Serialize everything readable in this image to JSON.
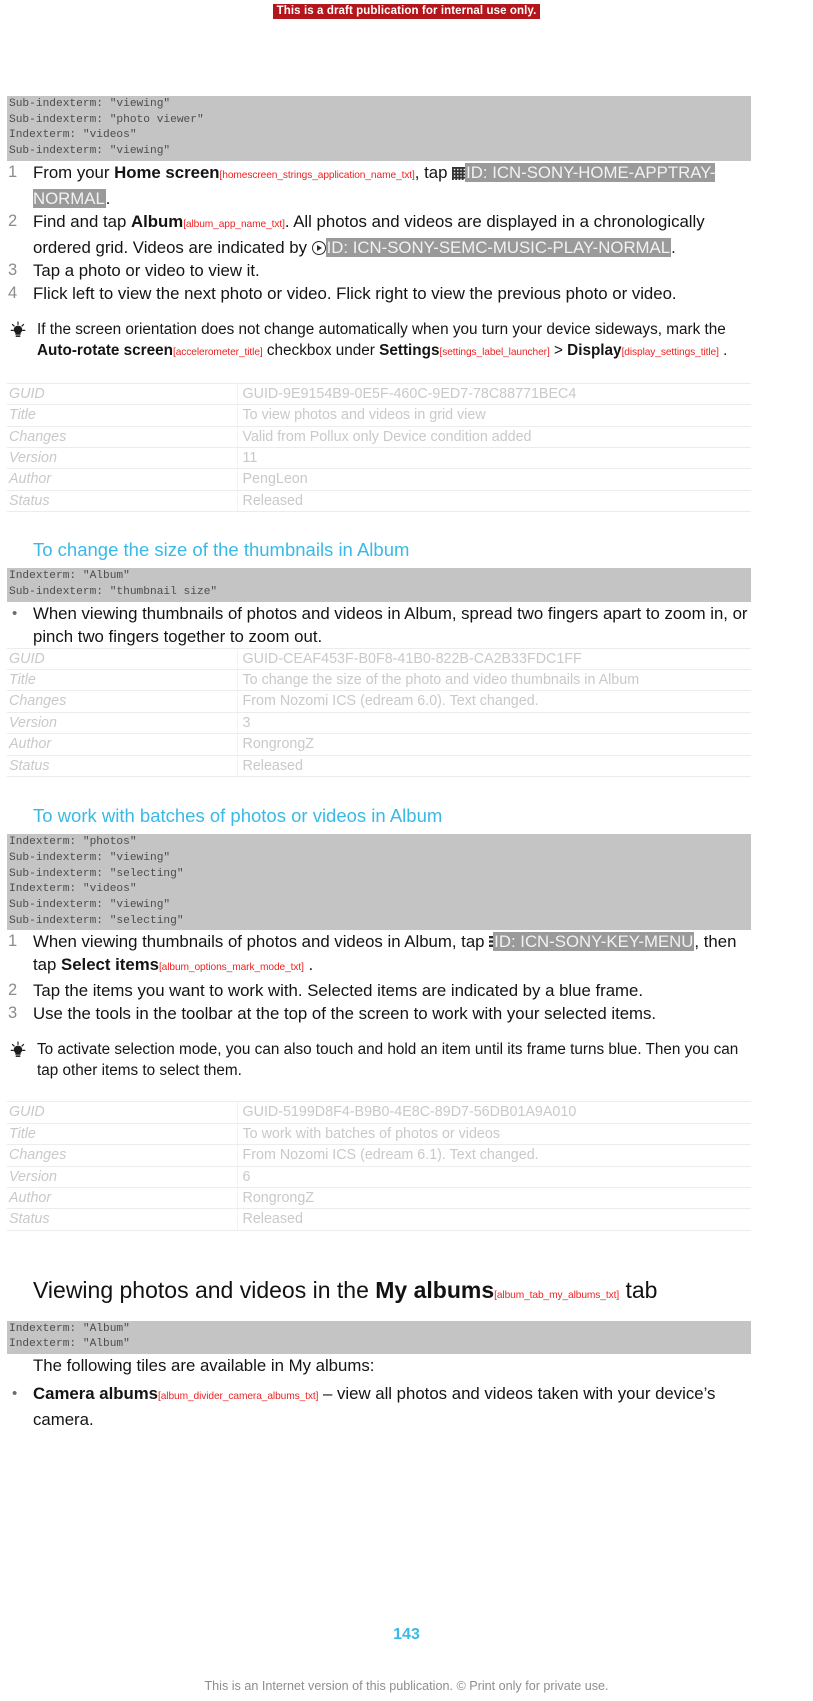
{
  "draft_banner": "This is a draft publication for internal use only.",
  "colors": {
    "accent": "#39b9e8",
    "draft_banner_bg": "#b3161b",
    "index_block_bg": "#c4c4c4",
    "string_id": "#ee2222",
    "icn_highlight": "#9a9a9a"
  },
  "section1": {
    "index_lines": [
      "Sub-indexterm: \"viewing\"",
      "Sub-indexterm: \"photo viewer\"",
      "Indexterm: \"videos\"",
      "Sub-indexterm: \"viewing\""
    ],
    "steps": [
      {
        "num": "1",
        "pre": "From your ",
        "ui1": "Home screen",
        "sid1": "[homescreen_strings_application_name_txt]",
        "mid": ", tap ",
        "icon": "apptray-grid-icon",
        "icn": "ID: ICN-SONY-HOME-APPTRAY-NORMAL",
        "post": "."
      },
      {
        "num": "2",
        "pre": "Find and tap ",
        "ui1": "Album",
        "sid1": "[album_app_name_txt]",
        "mid": ". All photos and videos are displayed in a chronologically ordered grid. Videos are indicated by ",
        "icon": "play-circle-icon",
        "icn": "ID: ICN-SONY-SEMC-MUSIC-PLAY-NORMAL",
        "post": "."
      },
      {
        "num": "3",
        "text": "Tap a photo or video to view it."
      },
      {
        "num": "4",
        "text": "Flick left to view the next photo or video. Flick right to view the previous photo or video."
      }
    ],
    "tip": {
      "p1": "If the screen orientation does not change automatically when you turn your device sideways, mark the ",
      "ui1": "Auto-rotate screen",
      "sid1": "[accelerometer_title]",
      "p2": " checkbox under ",
      "ui2": "Settings",
      "sid2": "[settings_label_launcher]",
      "p3": " > ",
      "ui3": "Display",
      "sid3": "[display_settings_title]",
      "p4": " ."
    },
    "meta": {
      "rows": [
        {
          "key": "GUID",
          "value": "GUID-9E9154B9-0E5F-460C-9ED7-78C88771BEC4"
        },
        {
          "key": "Title",
          "value": "To view photos and videos in grid view"
        },
        {
          "key": "Changes",
          "value": "Valid from Pollux only Device condition added"
        },
        {
          "key": "Version",
          "value": "11"
        },
        {
          "key": "Author",
          "value": "PengLeon"
        },
        {
          "key": "Status",
          "value": "Released"
        }
      ]
    }
  },
  "section2": {
    "heading": "To change the size of the thumbnails in Album",
    "index_lines": [
      "Indexterm: \"Album\"",
      "Sub-indexterm: \"thumbnail size\""
    ],
    "bullets": [
      "When viewing thumbnails of photos and videos in Album, spread two fingers apart to zoom in, or pinch two fingers together to zoom out."
    ],
    "meta": {
      "rows": [
        {
          "key": "GUID",
          "value": "GUID-CEAF453F-B0F8-41B0-822B-CA2B33FDC1FF"
        },
        {
          "key": "Title",
          "value": "To change the size of the photo and video thumbnails in Album"
        },
        {
          "key": "Changes",
          "value": "From Nozomi ICS (edream 6.0). Text changed."
        },
        {
          "key": "Version",
          "value": "3"
        },
        {
          "key": "Author",
          "value": "RongrongZ"
        },
        {
          "key": "Status",
          "value": "Released"
        }
      ]
    }
  },
  "section3": {
    "heading": "To work with batches of photos or videos in Album",
    "index_lines": [
      "Indexterm: \"photos\"",
      "Sub-indexterm: \"viewing\"",
      "Sub-indexterm: \"selecting\"",
      "Indexterm: \"videos\"",
      "Sub-indexterm: \"viewing\"",
      "Sub-indexterm: \"selecting\""
    ],
    "steps": [
      {
        "num": "1",
        "pre": "When viewing thumbnails of photos and videos in Album, tap ",
        "icon": "overflow-menu-icon",
        "icn": "ID: ICN-SONY-KEY-MENU",
        "mid": ", then tap ",
        "ui1": "Select items",
        "sid1": "[album_options_mark_mode_txt]",
        "post": " ."
      },
      {
        "num": "2",
        "text": "Tap the items you want to work with. Selected items are indicated by a blue frame."
      },
      {
        "num": "3",
        "text": "Use the tools in the toolbar at the top of the screen to work with your selected items."
      }
    ],
    "tip": {
      "text": "To activate selection mode, you can also touch and hold an item until its frame turns blue. Then you can tap other items to select them."
    },
    "meta": {
      "rows": [
        {
          "key": "GUID",
          "value": "GUID-5199D8F4-B9B0-4E8C-89D7-56DB01A9A010"
        },
        {
          "key": "Title",
          "value": "To work with batches of photos or videos"
        },
        {
          "key": "Changes",
          "value": "From Nozomi ICS (edream 6.1). Text changed."
        },
        {
          "key": "Version",
          "value": "6"
        },
        {
          "key": "Author",
          "value": "RongrongZ"
        },
        {
          "key": "Status",
          "value": "Released"
        }
      ]
    }
  },
  "section4": {
    "heading_pre": "Viewing photos and videos in the ",
    "heading_ui": "My albums",
    "heading_sid": "[album_tab_my_albums_txt]",
    "heading_post": " tab",
    "index_lines": [
      "Indexterm: \"Album\"",
      "Indexterm: \"Album\""
    ],
    "intro": "The following tiles are available in My albums:",
    "bullets": [
      {
        "ui": "Camera albums",
        "sid": "[album_divider_camera_albums_txt]",
        "text": " – view all photos and videos taken with your device’s camera."
      }
    ]
  },
  "footer": {
    "page_number": "143",
    "note": "This is an Internet version of this publication. © Print only for private use."
  }
}
